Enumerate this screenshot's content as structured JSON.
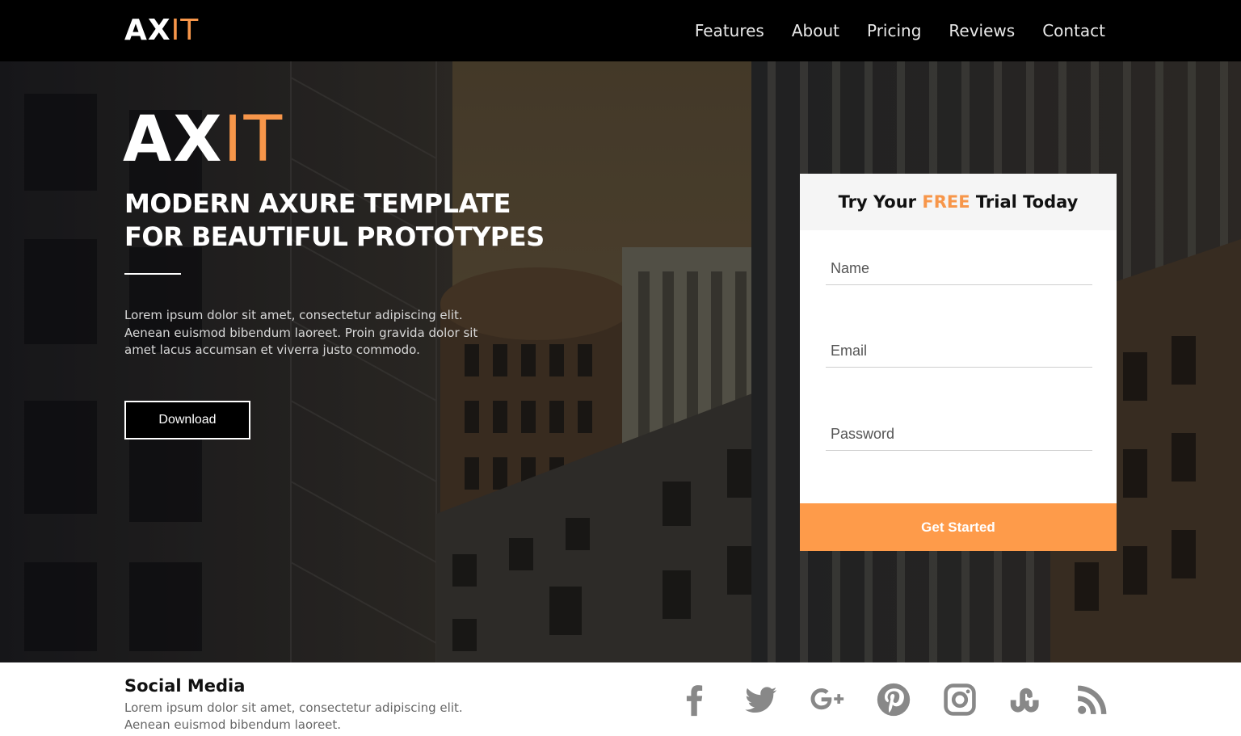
{
  "brand": {
    "main": "AX",
    "accent": "IT"
  },
  "nav": {
    "items": [
      {
        "label": "Features"
      },
      {
        "label": "About"
      },
      {
        "label": "Pricing"
      },
      {
        "label": "Reviews"
      },
      {
        "label": "Contact"
      }
    ]
  },
  "hero": {
    "logo_main": "AX",
    "logo_accent": "IT",
    "headline_line1": "MODERN AXURE TEMPLATE",
    "headline_line2": "FOR BEAUTIFUL PROTOTYPES",
    "lead": "Lorem ipsum dolor sit amet, consectetur adipiscing elit. Aenean euismod bibendum laoreet. Proin gravida dolor sit amet lacus accumsan et viverra justo commodo.",
    "download_label": "Download"
  },
  "signup": {
    "title_before": "Try Your ",
    "title_highlight": "FREE",
    "title_after": " Trial Today",
    "name_placeholder": "Name",
    "email_placeholder": "Email",
    "password_placeholder": "Password",
    "submit_label": "Get Started"
  },
  "footer": {
    "title": "Social Media",
    "text": "Lorem ipsum dolor sit amet, consectetur adipiscing elit. Aenean euismod bibendum laoreet.",
    "icons": [
      "facebook-icon",
      "twitter-icon",
      "google-plus-icon",
      "pinterest-icon",
      "instagram-icon",
      "stumbleupon-icon",
      "rss-icon"
    ]
  },
  "colors": {
    "accent": "#f7964a",
    "button": "#fe9b4a",
    "navbar": "#000000",
    "icon_gray": "#888888"
  }
}
